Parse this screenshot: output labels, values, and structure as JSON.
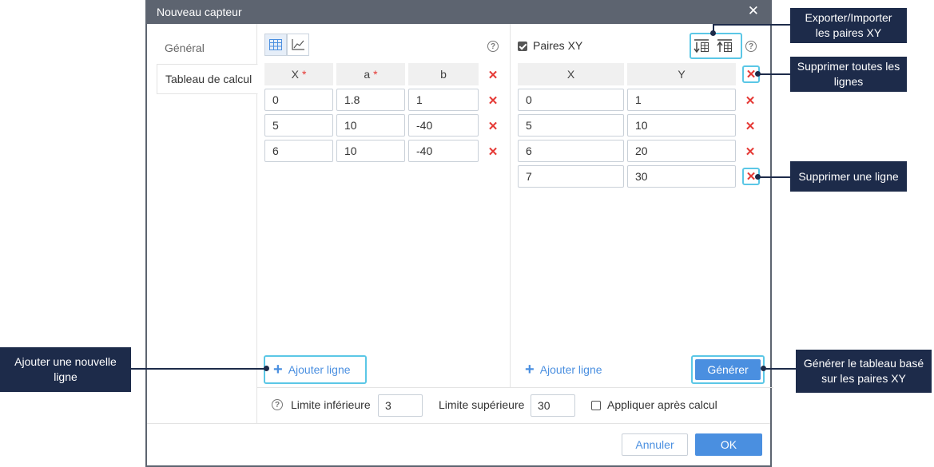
{
  "dialog": {
    "title": "Nouveau capteur",
    "close": "✕"
  },
  "sidebar": {
    "items": [
      {
        "label": "Général"
      },
      {
        "label": "Tableau de calcul"
      }
    ]
  },
  "calc_table": {
    "headers": [
      "X",
      "a",
      "b"
    ],
    "required_marker": "*",
    "rows": [
      [
        "0",
        "1.8",
        "1"
      ],
      [
        "5",
        "10",
        "-40"
      ],
      [
        "6",
        "10",
        "-40"
      ]
    ],
    "add_row_label": "Ajouter ligne"
  },
  "xy_pairs": {
    "checkbox_label": "Paires XY",
    "checked": true,
    "headers": [
      "X",
      "Y"
    ],
    "rows": [
      [
        "0",
        "1"
      ],
      [
        "5",
        "10"
      ],
      [
        "6",
        "20"
      ],
      [
        "7",
        "30"
      ]
    ],
    "add_row_label": "Ajouter ligne",
    "generate_label": "Générer"
  },
  "limits": {
    "lower_label": "Limite inférieure",
    "lower_value": "3",
    "upper_label": "Limite supérieure",
    "upper_value": "30",
    "apply_label": "Appliquer après calcul",
    "apply_checked": false
  },
  "footer": {
    "cancel_label": "Annuler",
    "ok_label": "OK"
  },
  "callouts": {
    "export_import": "Exporter/Importer les paires XY",
    "delete_all": "Supprimer toutes les lignes",
    "delete_one": "Supprimer une ligne",
    "add_new": "Ajouter une nouvelle ligne",
    "generate": "Générer le tableau basé sur les paires XY"
  },
  "colors": {
    "accent": "#4a8fe0",
    "titlebar": "#5d6470",
    "delete": "#e53935",
    "highlight": "#5bc7e6",
    "callout_bg": "#1d2b4a"
  },
  "icons": {
    "table_view": "table-icon",
    "chart_view": "chart-icon",
    "export": "export-icon",
    "import": "import-icon",
    "help": "help-icon",
    "delete": "delete-icon",
    "add": "plus-icon"
  }
}
